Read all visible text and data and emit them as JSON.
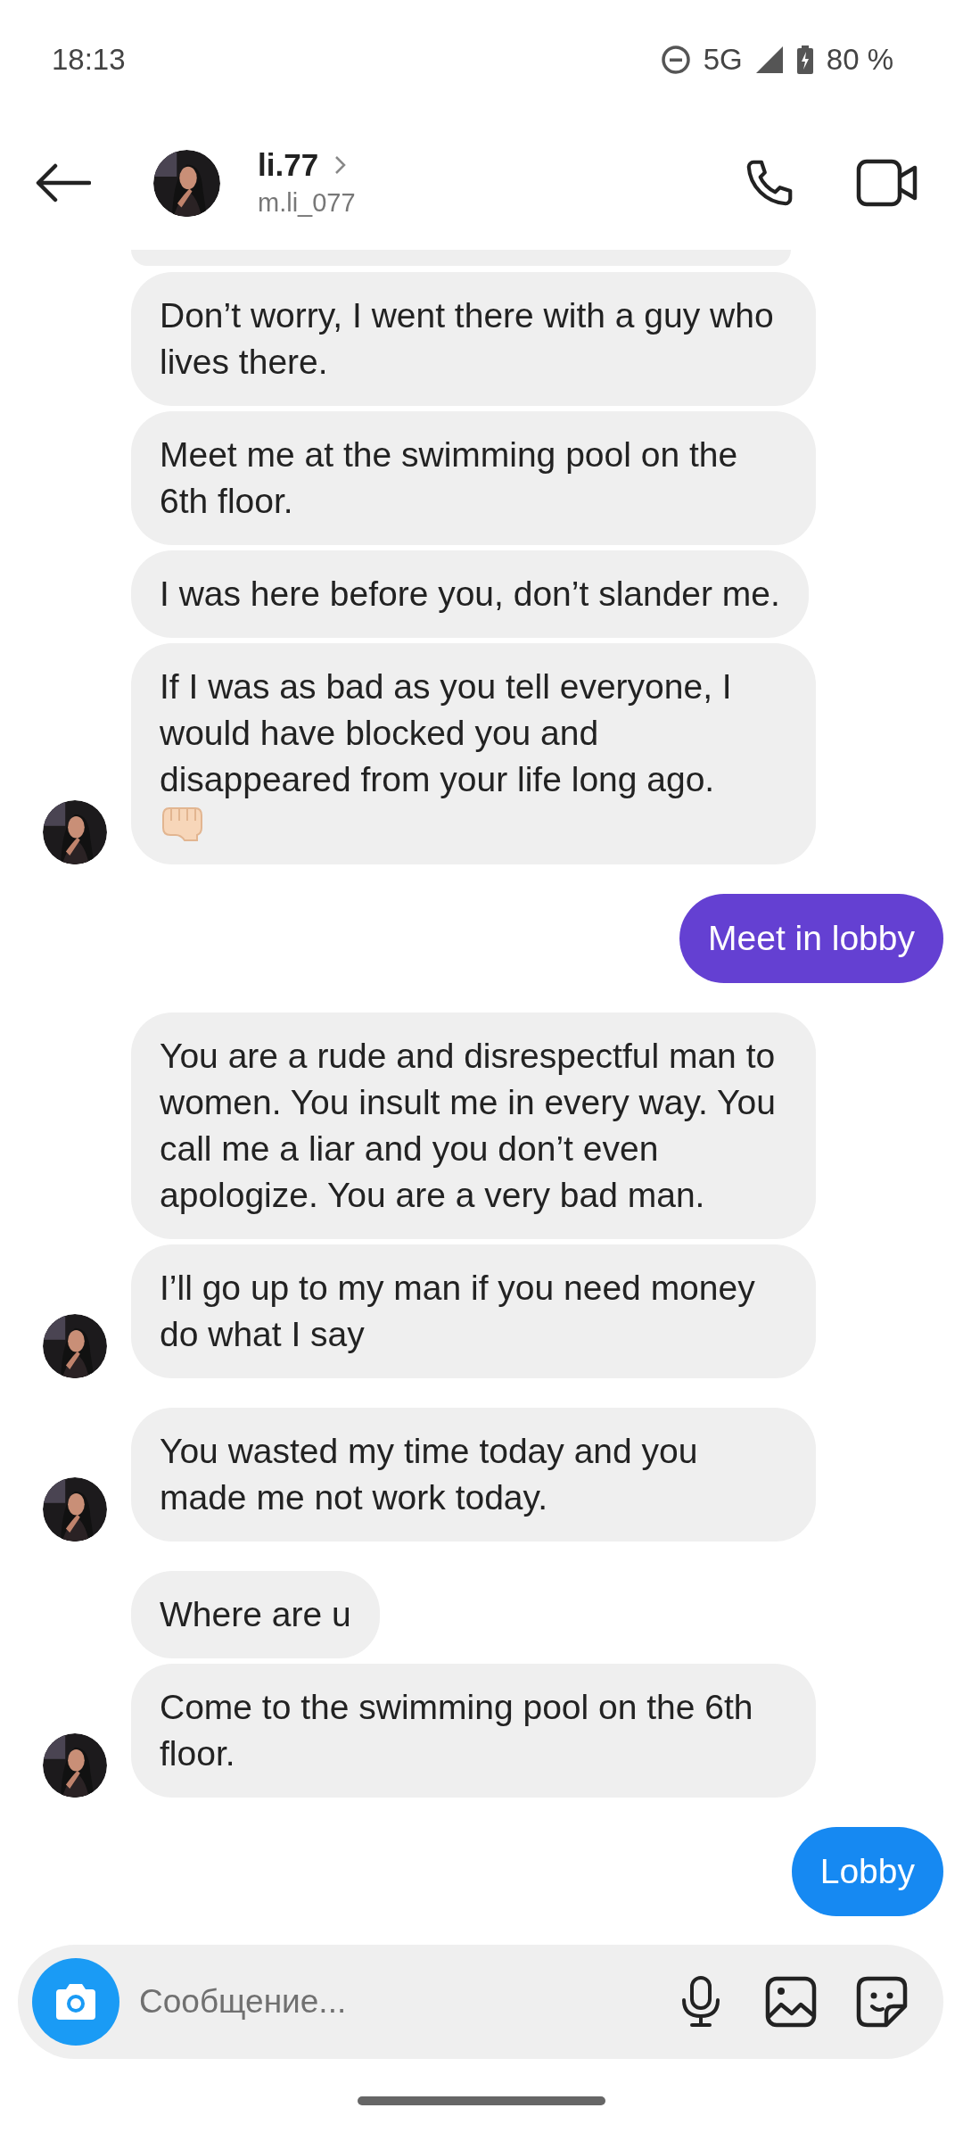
{
  "status_bar": {
    "time": "18:13",
    "network": "5G",
    "battery": "80 %"
  },
  "header": {
    "name": "li.77",
    "username": "m.li_077"
  },
  "message_groups": [
    {
      "kind": "received",
      "messages": [
        {
          "text": "Don’t worry, I went there with a guy who lives there.",
          "fist_emoji": false
        },
        {
          "text": "Meet me at the swimming pool on the 6th floor.",
          "fist_emoji": false
        },
        {
          "text": "I was here before you, don’t slander me.",
          "fist_emoji": false
        },
        {
          "text": "If I was as bad as you tell everyone, I would have blocked you and disappeared from your life long ago.",
          "fist_emoji": true
        }
      ]
    },
    {
      "kind": "sent",
      "messages": [
        {
          "text": "Meet in lobby",
          "color": "#6440d2"
        }
      ]
    },
    {
      "kind": "received",
      "messages": [
        {
          "text": "You are a rude and disrespectful man to women. You insult me in every way. You call me a liar and you don’t even apologize. You are a very bad man.",
          "fist_emoji": false
        },
        {
          "text": "I’ll go up to my man if you need money do what I say",
          "fist_emoji": false
        }
      ]
    },
    {
      "kind": "received",
      "messages": [
        {
          "text": "You wasted my time today and you made me not work today.",
          "fist_emoji": false
        }
      ]
    },
    {
      "kind": "received",
      "messages": [
        {
          "text": "Where are u",
          "fist_emoji": false
        },
        {
          "text": "Come to the swimming pool on the 6th floor.",
          "fist_emoji": false
        }
      ]
    },
    {
      "kind": "sent",
      "messages": [
        {
          "text": "Lobby",
          "color": "#1689f2"
        }
      ]
    }
  ],
  "composer": {
    "placeholder": "Сообщение..."
  }
}
